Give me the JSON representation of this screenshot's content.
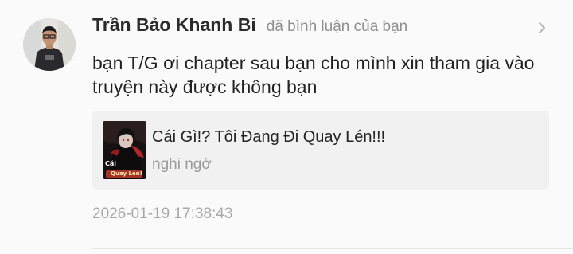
{
  "notification": {
    "user_name": "Trần Bảo Khanh Bi",
    "action_text": "đã bình luận của bạn",
    "comment": "bạn T/G ơi chapter sau bạn cho mình xin tham gia vào truyện này được không bạn",
    "timestamp": "2026-01-19 17:38:43",
    "chevron_icon": "chevron-right-icon",
    "avatar_icon": "user-avatar-photo"
  },
  "linked_story": {
    "title": "Cái Gì!? Tôi Đang Đi Quay Lén!!!",
    "subtitle": "nghi ngờ",
    "cover_icon": "story-cover-image",
    "cover_text": [
      "Cái",
      "Quay Lén!"
    ]
  },
  "colors": {
    "background": "#fafafa",
    "card_background": "#f1f1f1",
    "name_color": "#2b2b2b",
    "muted_text": "#8f8f8f",
    "cover_accent": "#c0392b"
  }
}
